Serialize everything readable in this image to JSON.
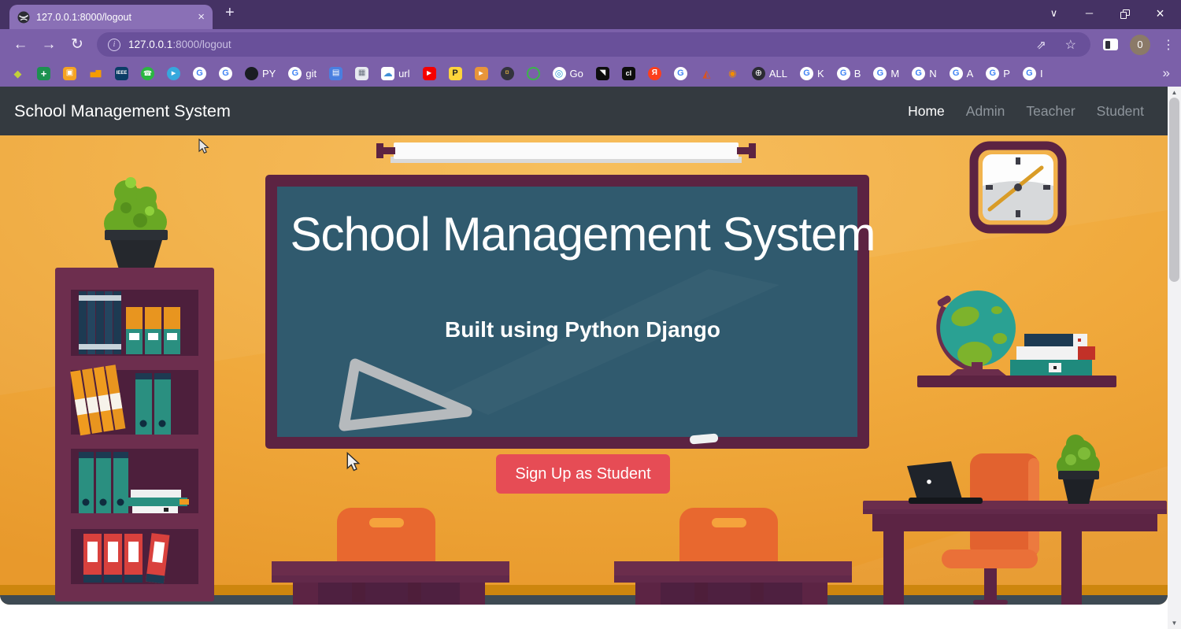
{
  "browser": {
    "tab": {
      "title": "127.0.0.1:8000/logout",
      "close_glyph": "×",
      "new_tab_glyph": "+"
    },
    "window_controls": {
      "menu": "∨",
      "minimize": "─",
      "close": "×"
    },
    "toolbar": {
      "back": "←",
      "forward": "→",
      "reload": "↻",
      "share": "⇗",
      "star": "☆",
      "menu_dots": "⋮",
      "profile_label": "0"
    },
    "address": {
      "host": "127.0.0.1",
      "path": ":8000/logout"
    },
    "bookmarks": {
      "overflow": "»",
      "items": [
        {
          "name": "google-ads",
          "shape": "none",
          "glyph": "◆",
          "fg": "#c2cf3a",
          "fs": 13
        },
        {
          "name": "green-cross",
          "shape": "square",
          "bg": "#1c9150",
          "glyph": "+",
          "fg": "#fff",
          "fs": 13,
          "bold": true
        },
        {
          "name": "orange-box",
          "shape": "square",
          "bg": "#f5a322",
          "glyph": "▣",
          "fg": "#ffffff",
          "fs": 10
        },
        {
          "name": "signal-bars",
          "shape": "none",
          "glyph": "▅▇",
          "fg": "#f59b00",
          "fs": 9
        },
        {
          "name": "ieee",
          "shape": "square",
          "bg": "#0b3d66",
          "glyph": "IEEE",
          "fg": "#fff",
          "fs": 6,
          "bold": true
        },
        {
          "name": "whatsapp",
          "shape": "circle",
          "bg": "#2bb741",
          "glyph": "☎",
          "fg": "#fff",
          "fs": 9
        },
        {
          "name": "telegram",
          "shape": "circle",
          "bg": "#36a8dd",
          "glyph": "▸",
          "fg": "#fff",
          "fs": 11
        },
        {
          "name": "google-g-1",
          "shape": "circle",
          "bg": "#ffffff",
          "glyph": "G",
          "fg": "#4285f4",
          "fs": 11,
          "bold": true
        },
        {
          "name": "google-g-2",
          "shape": "circle",
          "bg": "#ffffff",
          "glyph": "G",
          "fg": "#4285f4",
          "fs": 11,
          "bold": true
        },
        {
          "name": "github-py",
          "shape": "circle",
          "bg": "#191d22",
          "glyph": "",
          "label": "PY"
        },
        {
          "name": "google-git",
          "shape": "circle",
          "bg": "#ffffff",
          "glyph": "G",
          "fg": "#4285f4",
          "fs": 11,
          "bold": true,
          "label": "git"
        },
        {
          "name": "film",
          "shape": "square",
          "bg": "#4a7fe0",
          "glyph": "▤",
          "fg": "#fff",
          "fs": 10
        },
        {
          "name": "bank",
          "shape": "square",
          "bg": "#e7eaf0",
          "glyph": "▦",
          "fg": "#6a7380",
          "fs": 10
        },
        {
          "name": "cloud-url",
          "shape": "square",
          "bg": "#ffffff",
          "glyph": "☁",
          "fg": "#3f8fd6",
          "fs": 12,
          "label": "url"
        },
        {
          "name": "youtube",
          "shape": "square",
          "bg": "#f50000",
          "glyph": "▶",
          "fg": "#fff",
          "fs": 8
        },
        {
          "name": "python-p",
          "shape": "square",
          "bg": "#ffd43b",
          "glyph": "P",
          "fg": "#222222",
          "fs": 11,
          "bold": true
        },
        {
          "name": "movie-camera",
          "shape": "square",
          "bg": "#e8953a",
          "glyph": "▸",
          "fg": "#fff",
          "fs": 11
        },
        {
          "name": "cart",
          "shape": "circle",
          "bg": "#33333d",
          "glyph": "¤",
          "fg": "#e3b341",
          "fs": 10
        },
        {
          "name": "green-ring",
          "shape": "circle",
          "ring": "#3bb54a",
          "glyph": ""
        },
        {
          "name": "go-swirl",
          "shape": "circle",
          "bg": "#ffffff",
          "glyph": "◎",
          "fg": "#2e9cd6",
          "fs": 12,
          "label": "Go"
        },
        {
          "name": "eagle",
          "shape": "square",
          "bg": "#0d0d0d",
          "glyph": "◥",
          "fg": "#f5f5f5",
          "fs": 10
        },
        {
          "name": "cl",
          "shape": "square",
          "bg": "#0d0d0d",
          "glyph": "cl",
          "fg": "#fff",
          "fs": 9,
          "bold": true
        },
        {
          "name": "yandex",
          "shape": "circle",
          "bg": "#fc3f1d",
          "glyph": "Я",
          "fg": "#fff",
          "fs": 10,
          "bold": true
        },
        {
          "name": "google-g-3",
          "shape": "circle",
          "bg": "#ffffff",
          "glyph": "G",
          "fg": "#4285f4",
          "fs": 11,
          "bold": true
        },
        {
          "name": "matlab",
          "shape": "none",
          "glyph": "◭",
          "fg": "#d9541f",
          "fs": 13
        },
        {
          "name": "eye",
          "shape": "none",
          "glyph": "◉",
          "fg": "#f08c00",
          "fs": 12
        },
        {
          "name": "globe-all",
          "shape": "circle",
          "bg": "#2b2b33",
          "glyph": "⊕",
          "fg": "#fff",
          "fs": 11,
          "label": "ALL"
        },
        {
          "name": "google-k",
          "shape": "circle",
          "bg": "#ffffff",
          "glyph": "G",
          "fg": "#4285f4",
          "fs": 11,
          "bold": true,
          "label": "K"
        },
        {
          "name": "google-b",
          "shape": "circle",
          "bg": "#ffffff",
          "glyph": "G",
          "fg": "#4285f4",
          "fs": 11,
          "bold": true,
          "label": "B"
        },
        {
          "name": "google-m",
          "shape": "circle",
          "bg": "#ffffff",
          "glyph": "G",
          "fg": "#4285f4",
          "fs": 11,
          "bold": true,
          "label": "M"
        },
        {
          "name": "google-n",
          "shape": "circle",
          "bg": "#ffffff",
          "glyph": "G",
          "fg": "#4285f4",
          "fs": 11,
          "bold": true,
          "label": "N"
        },
        {
          "name": "google-a",
          "shape": "circle",
          "bg": "#ffffff",
          "glyph": "G",
          "fg": "#4285f4",
          "fs": 11,
          "bold": true,
          "label": "A"
        },
        {
          "name": "google-p",
          "shape": "circle",
          "bg": "#ffffff",
          "glyph": "G",
          "fg": "#4285f4",
          "fs": 11,
          "bold": true,
          "label": "P"
        },
        {
          "name": "google-i",
          "shape": "circle",
          "bg": "#ffffff",
          "glyph": "G",
          "fg": "#4285f4",
          "fs": 11,
          "bold": true,
          "label": "I"
        }
      ]
    }
  },
  "site": {
    "navbar": {
      "brand": "School Management System",
      "links": [
        {
          "label": "Home",
          "active": true
        },
        {
          "label": "Admin",
          "active": false
        },
        {
          "label": "Teacher",
          "active": false
        },
        {
          "label": "Student",
          "active": false
        }
      ]
    },
    "hero": {
      "board_title": "School Management System",
      "board_subtitle": "Built using Python Django",
      "cta_label": "Sign Up as Student"
    }
  },
  "colors": {
    "browser_frame": "#453264",
    "browser_toolbar": "#7b60a9",
    "address_bar": "#69509a",
    "tab_active": "#8a70b6",
    "navbar_dark": "#343a40",
    "nav_link_active": "#ffffff",
    "nav_link_muted": "#8e959c",
    "wall_orange": "#efa536",
    "board_teal": "#305a6e",
    "frame_maroon": "#5c2342",
    "button_red": "#e64c55",
    "scrollbar_thumb": "#c4c4c8"
  }
}
